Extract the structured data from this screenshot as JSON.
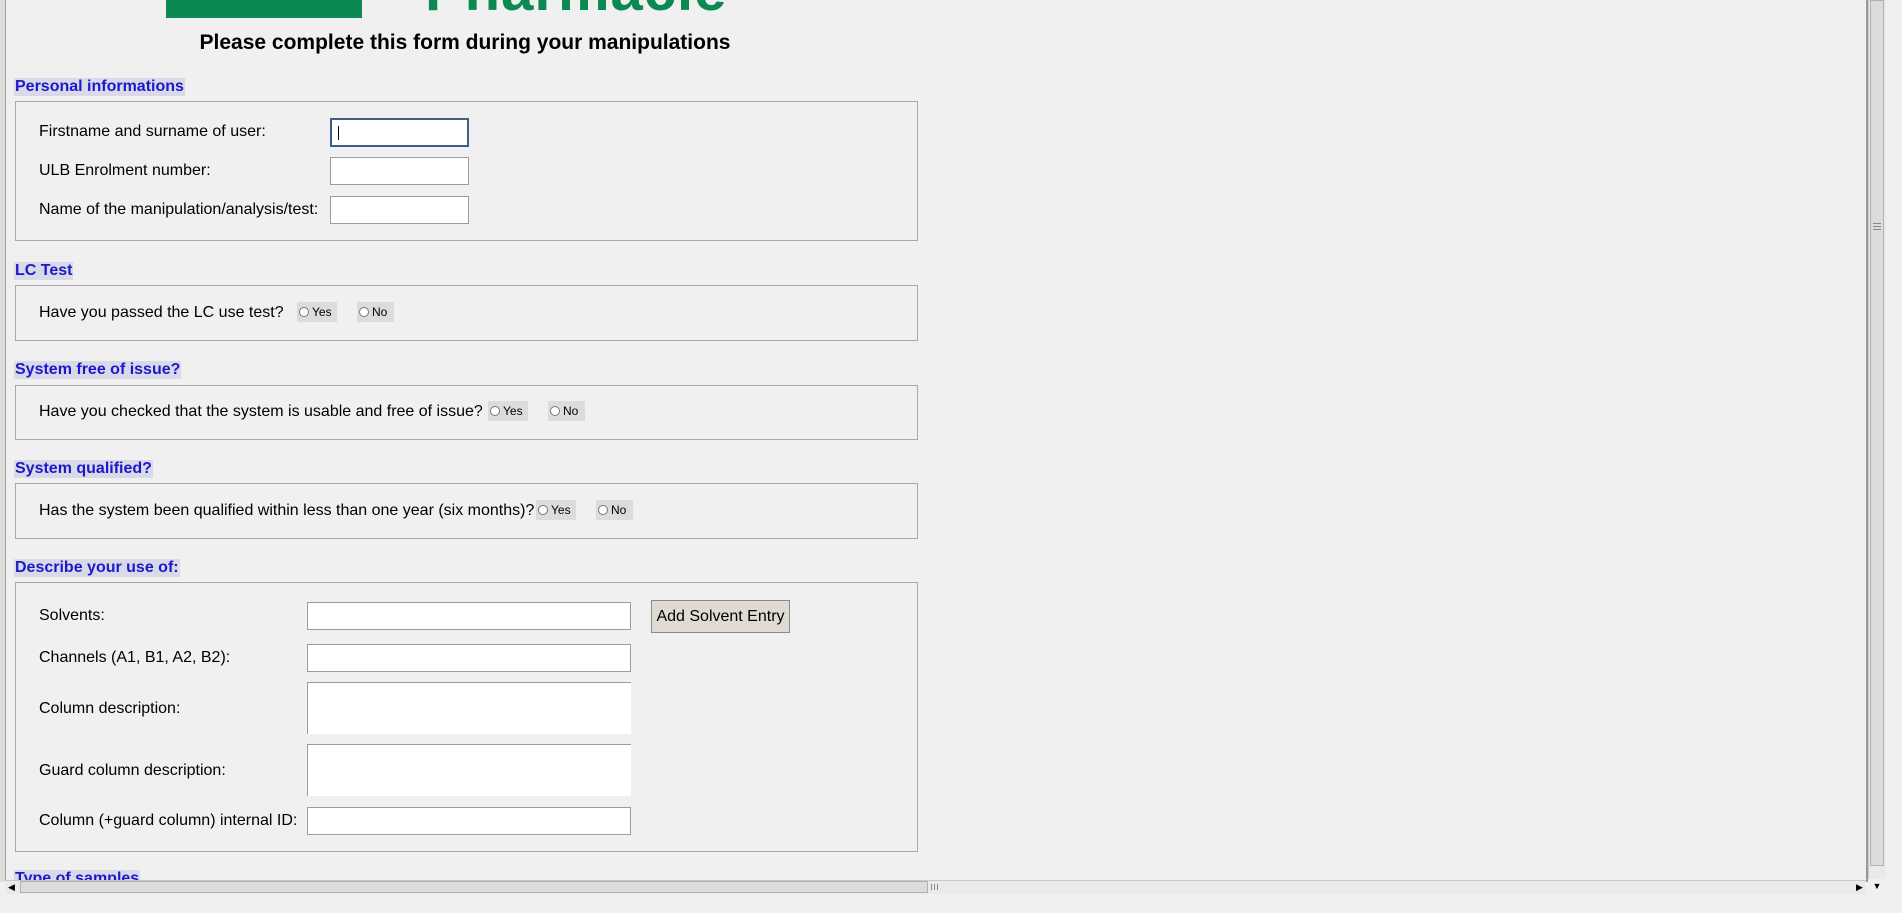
{
  "header": {
    "logo_text": "Pharmacie",
    "title": "Please complete this form during your manipulations"
  },
  "sections": {
    "personal": {
      "legend": "Personal informations",
      "name_label": "Firstname and surname of user:",
      "enrolment_label": "ULB Enrolment number:",
      "manipulation_label": "Name of the manipulation/analysis/test:"
    },
    "lc_test": {
      "legend": "LC Test",
      "question": "Have you passed the LC use test?",
      "yes": "Yes",
      "no": "No"
    },
    "system_free": {
      "legend": "System free of issue?",
      "question": "Have you checked that the system is usable and free of issue?",
      "yes": "Yes",
      "no": "No"
    },
    "system_qualified": {
      "legend": "System qualified?",
      "question": "Has the system been qualified within less than one year (six months)?",
      "yes": "Yes",
      "no": "No"
    },
    "use": {
      "legend": "Describe your use of:",
      "solvents_label": "Solvents:",
      "add_solvent_button": "Add Solvent Entry",
      "channels_label": "Channels (A1, B1, A2, B2):",
      "column_label": "Column description:",
      "guard_label": "Guard column description:",
      "internal_id_label": "Column (+guard column) internal ID:"
    },
    "samples": {
      "legend": "Type of samples"
    }
  },
  "colors": {
    "legend_text": "#1a1acc",
    "logo_green": "#0a8a52",
    "background": "#f0f0f0"
  },
  "icons": {
    "scroll_down": "triangle-down-icon",
    "scroll_left": "triangle-left-icon",
    "scroll_right": "triangle-right-icon"
  }
}
